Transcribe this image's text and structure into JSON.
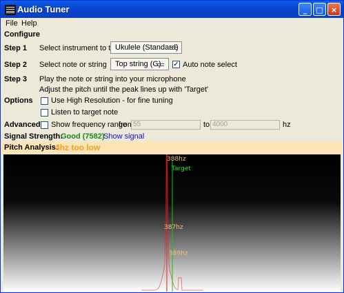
{
  "window": {
    "title": "Audio Tuner",
    "minimize_glyph": "_",
    "maximize_glyph": "□",
    "close_glyph": "×"
  },
  "menu": {
    "file": "File",
    "help": "Help"
  },
  "configure": {
    "heading": "Configure"
  },
  "step1": {
    "label": "Step 1",
    "text": "Select instrument to tune",
    "instrument": "Ukulele (Standard)"
  },
  "step2": {
    "label": "Step 2",
    "text": "Select note or string",
    "note": "Top string (G)",
    "auto_label": "Auto note select",
    "auto_checked": true
  },
  "step3": {
    "label": "Step 3",
    "line1": "Play the note or string into your microphone",
    "line2": "Adjust the pitch until the peak lines up with 'Target'"
  },
  "options": {
    "label": "Options",
    "high_res": "Use High Resolution - for fine tuning",
    "listen": "Listen to target note"
  },
  "advanced": {
    "label": "Advanced",
    "show_range": "Show frequency range",
    "from_label": "from",
    "from_value": "55",
    "to_label": "to",
    "to_value": "4000",
    "unit": "hz"
  },
  "signal": {
    "label": "Signal Strength:",
    "value": "Good (7582)",
    "link": "Show signal"
  },
  "pitch": {
    "label": "Pitch Analysis:",
    "value": "4hz too low"
  },
  "graph": {
    "labels": {
      "top": "388hz",
      "target": "Target",
      "mid": "387hz",
      "low": "389hz"
    },
    "detected_hz": 384,
    "target_hz": 388,
    "colors": {
      "detected": "#e82020",
      "target": "#18c418",
      "label": "#f0c080",
      "target_label": "#30e030"
    }
  },
  "colors": {
    "signal_good": "#1a8a1a",
    "link": "#1010d0",
    "pitch_value": "#f0a020"
  }
}
